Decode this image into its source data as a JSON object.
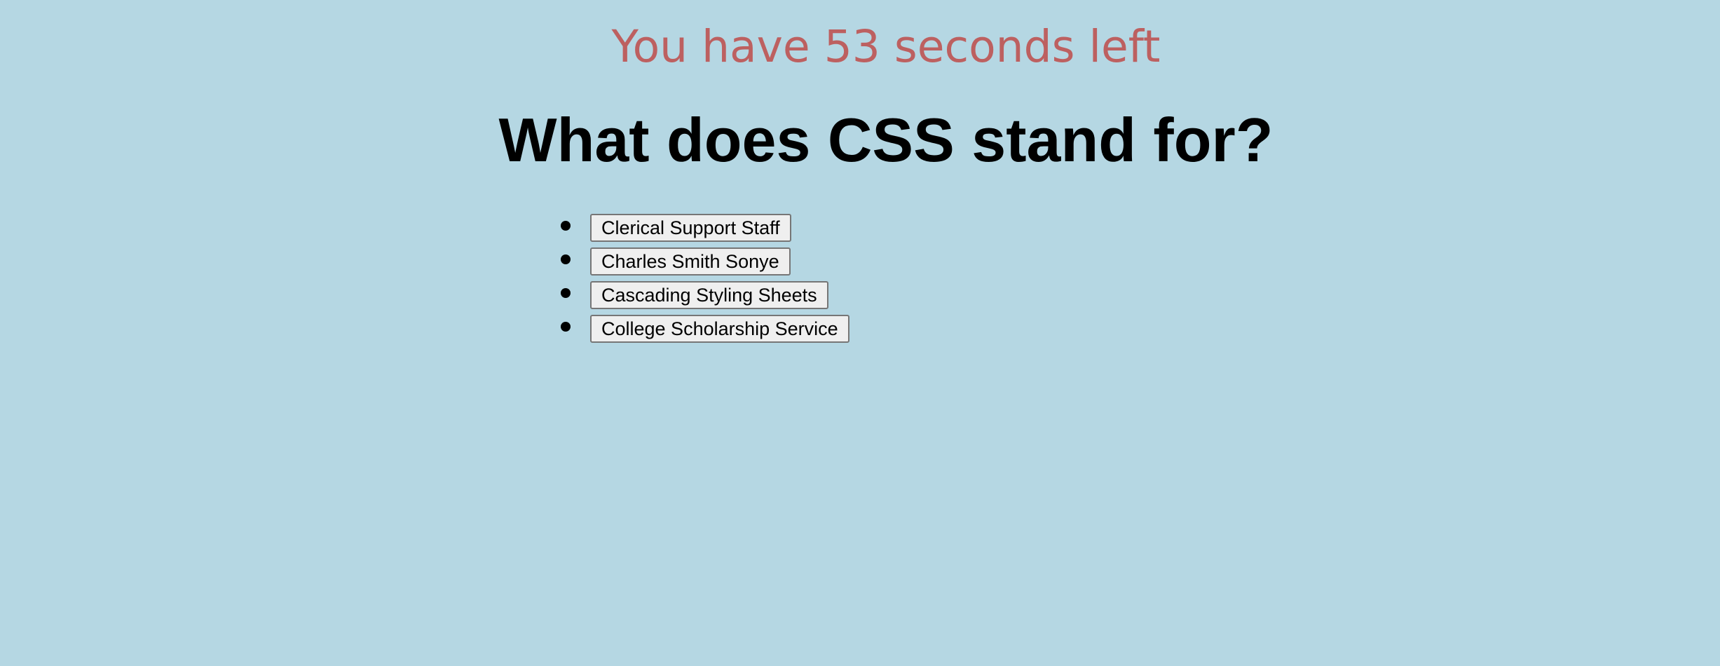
{
  "timer": {
    "text": "You have 53 seconds left",
    "color": "#bd6060"
  },
  "question": {
    "text": "What does CSS stand for?"
  },
  "answers": [
    "Clerical Support Staff",
    "Charles Smith Sonye",
    "Cascading Styling Sheets",
    "College Scholarship Service"
  ],
  "colors": {
    "background": "#b5d7e3",
    "button_background": "#efefef",
    "button_border": "#767676"
  }
}
